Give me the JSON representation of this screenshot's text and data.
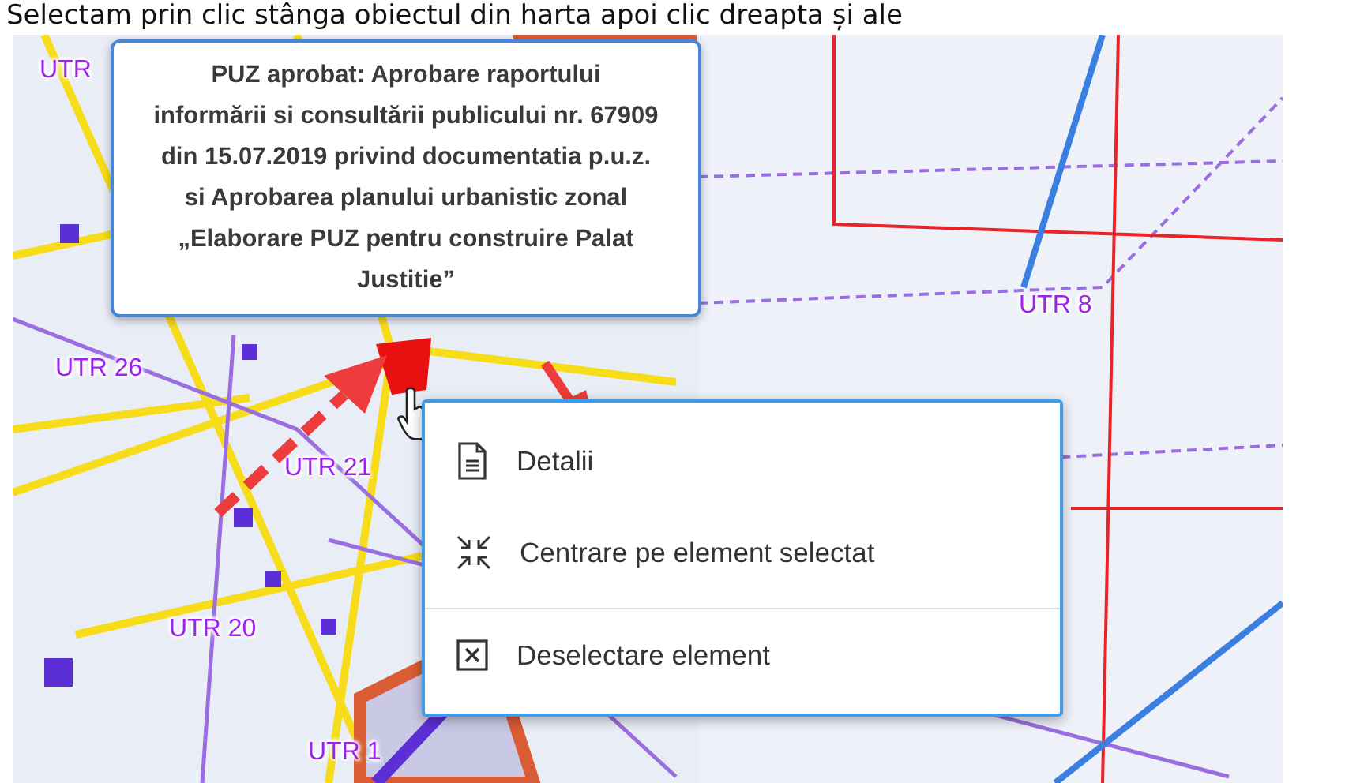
{
  "caption": "Selectam prin clic stânga obiectul din harta apoi clic dreapta și ale",
  "map": {
    "kind": "picture",
    "labels": [
      "UTR",
      "UTR 26",
      "UTR 21",
      "UTR 20",
      "UTR 1",
      "UTR 8"
    ],
    "tooltip": "PUZ aprobat: Aprobare raportului informării si consultării publicului nr. 67909 din 15.07.2019 privind documentatia p.u.z. si Aprobarea planului urbanistic zonal „Elaborare PUZ pentru construire Palat Justitie”",
    "context_menu": [
      {
        "kind": "document",
        "label": "Detalii",
        "divider_before": false
      },
      {
        "kind": "center",
        "label": "Centrare pe element selectat",
        "divider_before": false
      },
      {
        "kind": "close",
        "label": "Deselectare element",
        "divider_before": true
      }
    ]
  }
}
